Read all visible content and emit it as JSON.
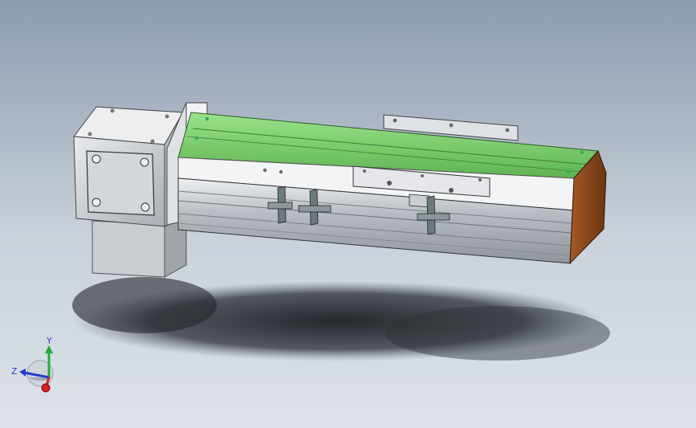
{
  "viewport": {
    "background_top": "#8d9cb0",
    "background_bottom": "#dde2e8"
  },
  "model": {
    "belt_color": "#7ccf6c",
    "end_cap_color": "#8a4a1f",
    "body_color": "#d9dcdf"
  },
  "triad": {
    "y_label": "Y",
    "z_label": "Z",
    "x_color": "#d81e1e",
    "y_color": "#1fae3a",
    "z_color": "#2a3bd0"
  }
}
